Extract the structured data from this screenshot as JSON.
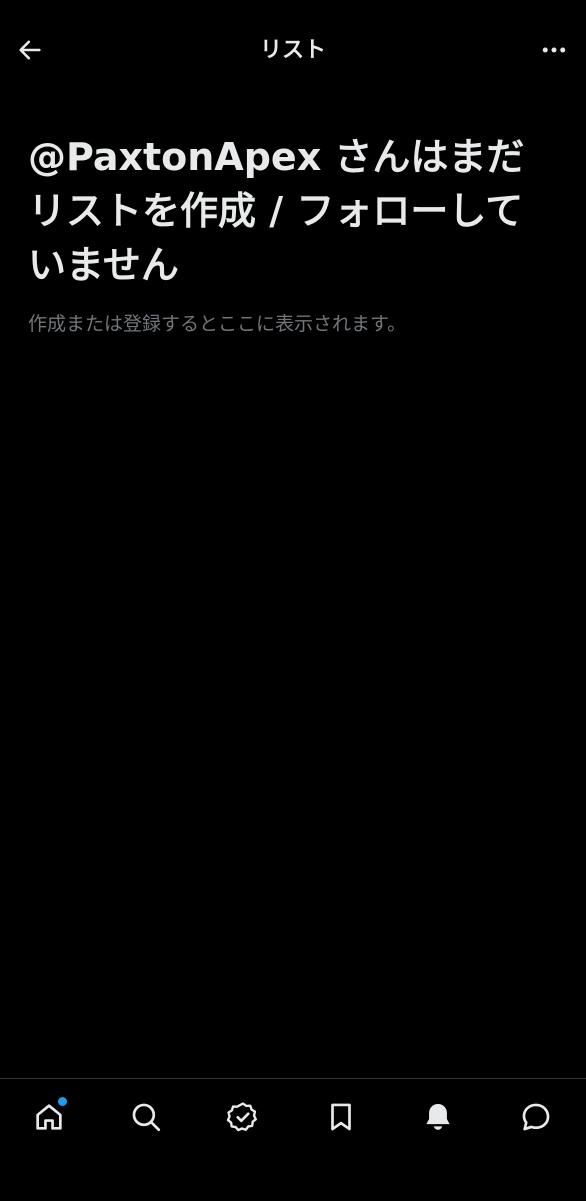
{
  "header": {
    "title": "リスト",
    "back_icon": "arrow-left-icon",
    "more_icon": "more-horizontal-icon"
  },
  "empty_state": {
    "title": "@PaxtonApex さんはまだリストを作成 / フォローしていません",
    "description": "作成または登録するとここに表示されます。"
  },
  "bottom_nav": {
    "items": [
      {
        "name": "home",
        "icon": "home-icon",
        "has_dot": true
      },
      {
        "name": "search",
        "icon": "search-icon"
      },
      {
        "name": "verified",
        "icon": "verified-badge-icon"
      },
      {
        "name": "bookmarks",
        "icon": "bookmark-icon"
      },
      {
        "name": "notifications",
        "icon": "bell-icon",
        "active": true
      },
      {
        "name": "messages",
        "icon": "chat-bubble-icon"
      }
    ]
  },
  "colors": {
    "background": "#000000",
    "text_primary": "#e7e9ea",
    "text_secondary": "#71767b",
    "accent": "#1d9bf0",
    "divider": "#2f3336"
  }
}
